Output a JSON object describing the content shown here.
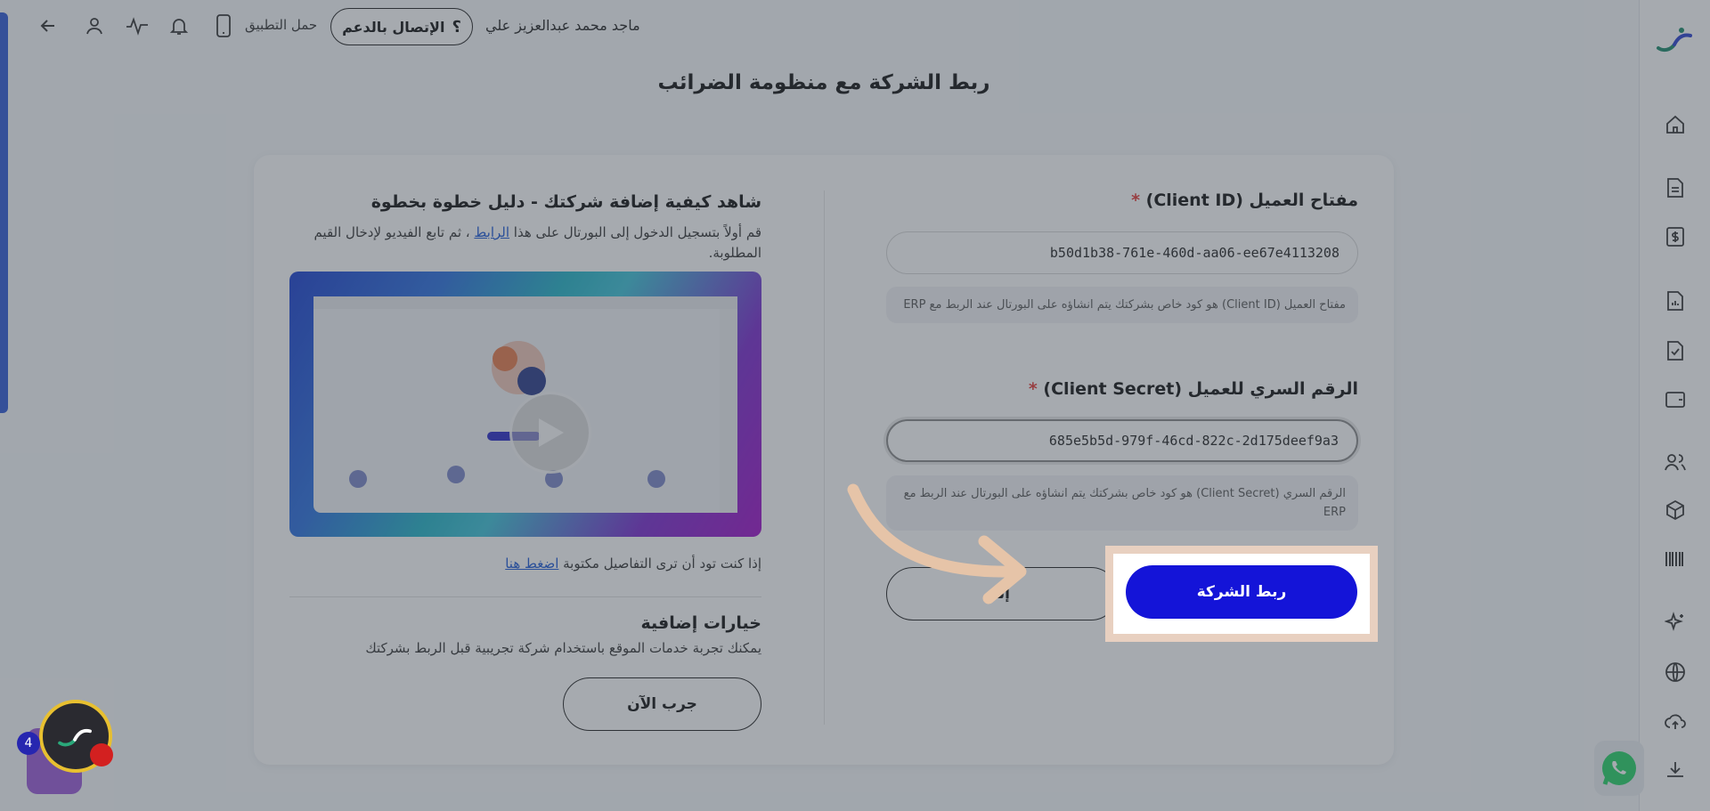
{
  "topbar": {
    "user_name": "ماجد محمد عبدالعزيز علي",
    "support_label": "الإتصال بالدعم",
    "support_icon_glyph": "؟",
    "download_app_label": "حمل التطبيق",
    "icons": [
      "back-arrow-icon",
      "user-icon",
      "activity-icon",
      "bell-icon",
      "phone-icon"
    ]
  },
  "page": {
    "title": "ربط الشركة مع منظومة الضرائب"
  },
  "form": {
    "client_id": {
      "label": "مفتاح العميل (Client ID)",
      "required_mark": "*",
      "value": "b50d1b38-761e-460d-aa06-ee67e4113208",
      "hint": "مفتاح العميل (Client ID) هو كود خاص بشركتك يتم انشاؤه على البورتال عند الربط مع ERP"
    },
    "client_secret": {
      "label": "الرقم السري للعميل (Client Secret)",
      "required_mark": "*",
      "value": "685e5b5d-979f-46cd-822c-2d175deef9a3",
      "hint": "الرقم السري (Client Secret) هو كود خاص بشركتك يتم انشاؤه على البورتال عند الربط مع ERP"
    },
    "secondary_button": "إلـ",
    "primary_button": "ربط الشركة"
  },
  "guide": {
    "title": "شاهد كيفية إضافة شركتك - دليل خطوة بخطوة",
    "desc_before_link": "قم أولاً بتسجيل الدخول إلى البورتال على هذا ",
    "desc_link": "الرابط",
    "desc_after_link": " ، ثم تابع الفيديو لإدخال القيم المطلوبة.",
    "details_text": "إذا كنت تود أن ترى التفاصيل مكتوبة ",
    "details_link": "اضغط هنا"
  },
  "extra": {
    "title": "خيارات إضافية",
    "desc": "يمكنك تجربة خدمات الموقع باستخدام شركة تجريبية قبل الربط بشركتك",
    "try_button": "جرب الآن"
  },
  "assistant": {
    "badge_count": "4"
  },
  "colors": {
    "primary": "#1414d8",
    "highlight_frame": "#e8d0c0",
    "arrow": "#e6c4a8",
    "required": "#e53935",
    "link": "#1a57d6"
  }
}
